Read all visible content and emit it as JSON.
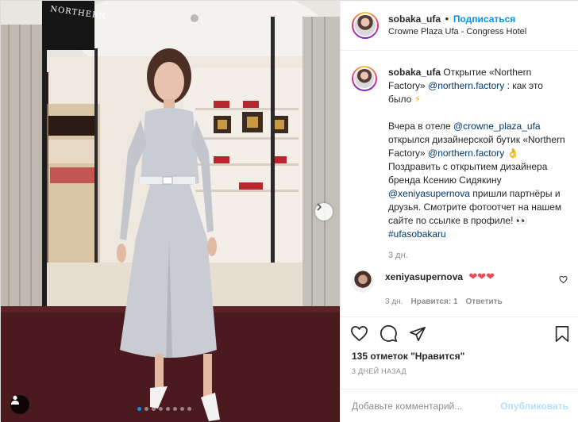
{
  "photo": {
    "store_sign": "NORTHERN",
    "carousel": {
      "dot_count": 8,
      "active_index": 0
    }
  },
  "header": {
    "username": "sobaka_ufa",
    "separator": "•",
    "follow_label": "Подписаться",
    "location": "Crowne Plaza Ufa - Congress Hotel"
  },
  "caption": {
    "username": "sobaka_ufa",
    "line1_a": "Открытие «Northern Factory»",
    "line1_mention": "@northern.factory",
    "line1_b": ": как это было",
    "line1_emoji": "⚡",
    "p2_a": "Вчера в отеле",
    "p2_mention1": "@crowne_plaza_ufa",
    "p2_b": "открылся дизайнерской бутик «Northern Factory»",
    "p2_mention2": "@northern.factory",
    "p2_emoji": "👌",
    "p2_c": "Поздравить с открытием дизайнера бренда Ксению Сидякину",
    "p2_mention3": "@xeniyasupernova",
    "p2_d": "пришли партнёры и друзья. Смотрите фотоотчет на нашем сайте по ссылке в профиле!",
    "p2_emoji2": "👀",
    "p2_hashtag": "#ufasobakaru",
    "time": "3 дн."
  },
  "comment": {
    "username": "xeniyasupernova",
    "text": "❤❤❤",
    "time": "3 дн.",
    "likes": "Нравится: 1",
    "reply": "Ответить"
  },
  "actions": {
    "like_icon": "heart-icon",
    "comment_icon": "comment-icon",
    "share_icon": "share-icon",
    "save_icon": "bookmark-icon"
  },
  "likes": {
    "count": "135 отметок",
    "text": "\"Нравится\""
  },
  "posted": "3 ДНЕЙ НАЗАД",
  "add_comment": {
    "placeholder": "Добавьте комментарий...",
    "post_label": "Опубликовать"
  }
}
